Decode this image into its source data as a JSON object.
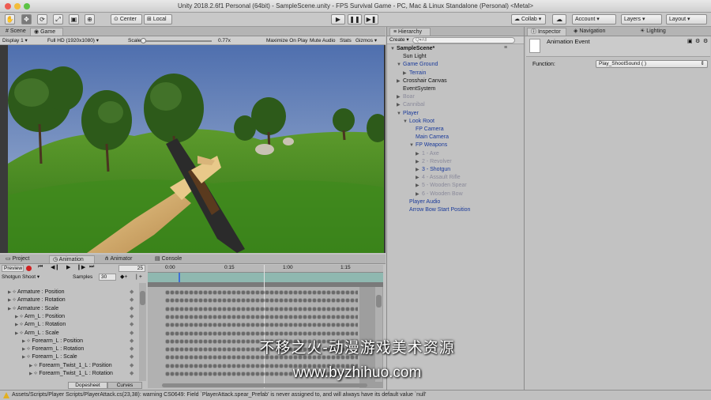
{
  "window": {
    "title": "Unity 2018.2.6f1 Personal (64bit) - SampleScene.unity - FPS Survival Game - PC, Mac & Linux Standalone (Personal) <Metal>"
  },
  "toolbar": {
    "center_label": "Center",
    "local_label": "Local",
    "collab_label": "Collab ▾",
    "account_label": "Account ▾",
    "layers_label": "Layers ▾",
    "layout_label": "Layout ▾"
  },
  "scene_tabs": {
    "scene": "Scene",
    "game": "Game"
  },
  "game_bar": {
    "display": "Display 1",
    "resolution": "Full HD (1920x1080)",
    "scale_label": "Scale",
    "scale_value": "0.77x",
    "maximize": "Maximize On Play",
    "mute": "Mute Audio",
    "stats": "Stats",
    "gizmos": "Gizmos ▾"
  },
  "hierarchy": {
    "tab": "Hierarchy",
    "create": "Create ▾",
    "search_placeholder": "Q▾All",
    "items": [
      {
        "label": "SampleScene*",
        "indent": 0,
        "arrow": "▼",
        "style": "hbold"
      },
      {
        "label": "Sun Light",
        "indent": 1,
        "arrow": "",
        "style": "hblack"
      },
      {
        "label": "Game Ground",
        "indent": 1,
        "arrow": "▼",
        "style": "hblue"
      },
      {
        "label": "Terrain",
        "indent": 2,
        "arrow": "▶",
        "style": "hblue"
      },
      {
        "label": "Crosshair Canvas",
        "indent": 1,
        "arrow": "▶",
        "style": "hblack"
      },
      {
        "label": "EventSystem",
        "indent": 1,
        "arrow": "",
        "style": "hblack"
      },
      {
        "label": "Boar",
        "indent": 1,
        "arrow": "▶",
        "style": "hgray"
      },
      {
        "label": "Cannibal",
        "indent": 1,
        "arrow": "▶",
        "style": "hgray"
      },
      {
        "label": "Player",
        "indent": 1,
        "arrow": "▼",
        "style": "hblue"
      },
      {
        "label": "Look Root",
        "indent": 2,
        "arrow": "▼",
        "style": "hblue"
      },
      {
        "label": "FP Camera",
        "indent": 3,
        "arrow": "",
        "style": "hblue"
      },
      {
        "label": "Main Camera",
        "indent": 3,
        "arrow": "",
        "style": "hblue"
      },
      {
        "label": "FP Weapons",
        "indent": 3,
        "arrow": "▼",
        "style": "hblue"
      },
      {
        "label": "1 - Axe",
        "indent": 4,
        "arrow": "▶",
        "style": "hgray"
      },
      {
        "label": "2 - Revolver",
        "indent": 4,
        "arrow": "▶",
        "style": "hgray"
      },
      {
        "label": "3 - Shotgun",
        "indent": 4,
        "arrow": "▶",
        "style": "hblue"
      },
      {
        "label": "4 - Assault Rifle",
        "indent": 4,
        "arrow": "▶",
        "style": "hgray"
      },
      {
        "label": "5 - Wooden Spear",
        "indent": 4,
        "arrow": "▶",
        "style": "hgray"
      },
      {
        "label": "6 - Wooden Bow",
        "indent": 4,
        "arrow": "▶",
        "style": "hgray"
      },
      {
        "label": "Player Audio",
        "indent": 2,
        "arrow": "",
        "style": "hblue"
      },
      {
        "label": "Arrow Bow Start Position",
        "indent": 2,
        "arrow": "",
        "style": "hblue"
      }
    ]
  },
  "inspector": {
    "tabs": [
      "Inspector",
      "Navigation",
      "Lighting"
    ],
    "object_name": "Animation Event",
    "function_label": "Function:",
    "function_value": "Play_ShootSound ( )"
  },
  "bottom_tabs": {
    "project": "Project",
    "animation": "Animation",
    "animator": "Animator",
    "console": "Console"
  },
  "animation": {
    "preview": "Preview",
    "frame": "25",
    "clip": "Shotgun Shoot",
    "samples_label": "Samples",
    "samples_value": "30",
    "ruler": [
      "0:00",
      "0:15",
      "1:00",
      "1:15"
    ],
    "properties": [
      {
        "label": "Armature : Position",
        "indent": 0
      },
      {
        "label": "Armature : Rotation",
        "indent": 0
      },
      {
        "label": "Armature : Scale",
        "indent": 0
      },
      {
        "label": "Arm_L : Position",
        "indent": 1
      },
      {
        "label": "Arm_L : Rotation",
        "indent": 1
      },
      {
        "label": "Arm_L : Scale",
        "indent": 1
      },
      {
        "label": "Forearm_L : Position",
        "indent": 2
      },
      {
        "label": "Forearm_L : Rotation",
        "indent": 2
      },
      {
        "label": "Forearm_L : Scale",
        "indent": 2
      },
      {
        "label": "Forearm_Twist_1_L : Position",
        "indent": 3
      },
      {
        "label": "Forearm_Twist_1_L : Rotation",
        "indent": 3
      }
    ],
    "dopesheet": "Dopesheet",
    "curves": "Curves"
  },
  "status": {
    "message": "Assets/Scripts/Player Scripts/PlayerAttack.cs(23,38): warning CS0649: Field `PlayerAttack.spear_Prefab' is never assigned to, and will always have its default value `null'"
  },
  "watermark": {
    "line1": "不移之火-动漫游戏美术资源",
    "line2": "www.byzhihuo.com"
  },
  "colors": {
    "sky": "#5f7fb8",
    "grass": "#3f8a1e",
    "selection": "#3d6fd6"
  }
}
